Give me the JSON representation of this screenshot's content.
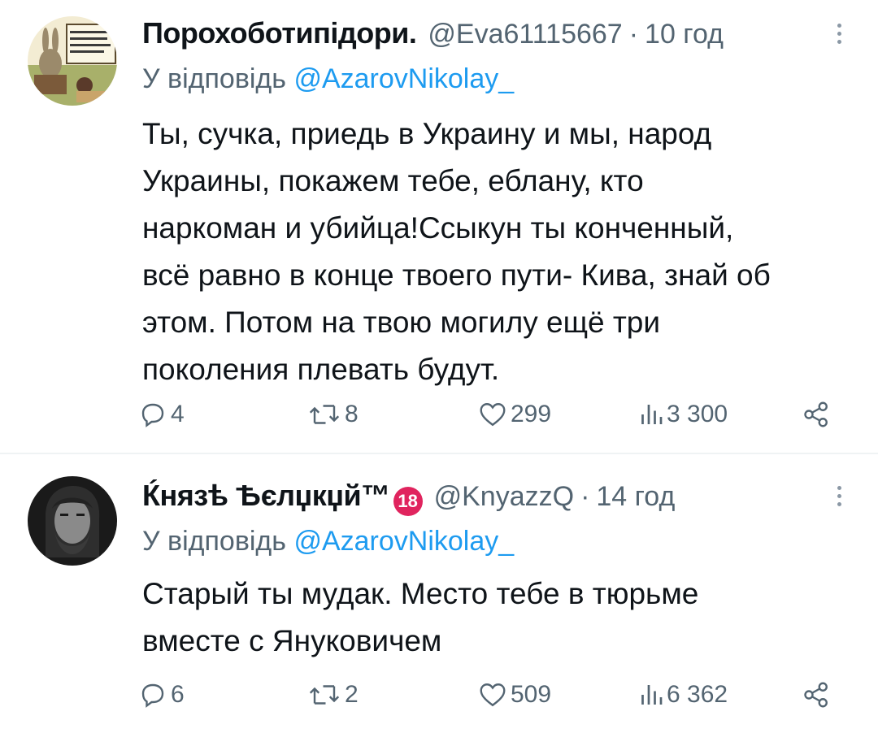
{
  "tweets": [
    {
      "name": "Порохоботипідори.",
      "handle": "@Eva61115667",
      "dot": "·",
      "time": "10 год",
      "reply_prefix": "У відповідь ",
      "reply_handle": "@AzarovNikolay_",
      "lines": [
        "Ты, сучка, приедь в Украину и мы, народ",
        "Украины, покажем тебе, еблану, кто",
        "наркоман и убийца!Ссыкун ты конченный,",
        "всё равно в конце твоего пути- Кива, знай об",
        "этом. Потом на твою могилу ещё три",
        "поколения плевать будут."
      ],
      "replies": "4",
      "retweets": "8",
      "likes": "299",
      "views": "3 300"
    },
    {
      "name": "Ќнязѣ Ѣєлџкџй™",
      "badge": "18",
      "handle": "@KnyazzQ",
      "dot": "·",
      "time": "14 год",
      "reply_prefix": "У відповідь ",
      "reply_handle": "@AzarovNikolay_",
      "lines": [
        "Старый ты мудак. Место тебе в тюрьме",
        "вместе с Януковичем"
      ],
      "replies": "6",
      "retweets": "2",
      "likes": "509",
      "views": "6 362"
    }
  ],
  "colors": {
    "text": "#0f1419",
    "secondary": "#536471",
    "link": "#1d9bf0",
    "divider": "#eff3f4",
    "badge": "#e0245e"
  },
  "icons": [
    "reply-icon",
    "retweet-icon",
    "like-icon",
    "views-icon",
    "share-icon",
    "more-icon"
  ]
}
